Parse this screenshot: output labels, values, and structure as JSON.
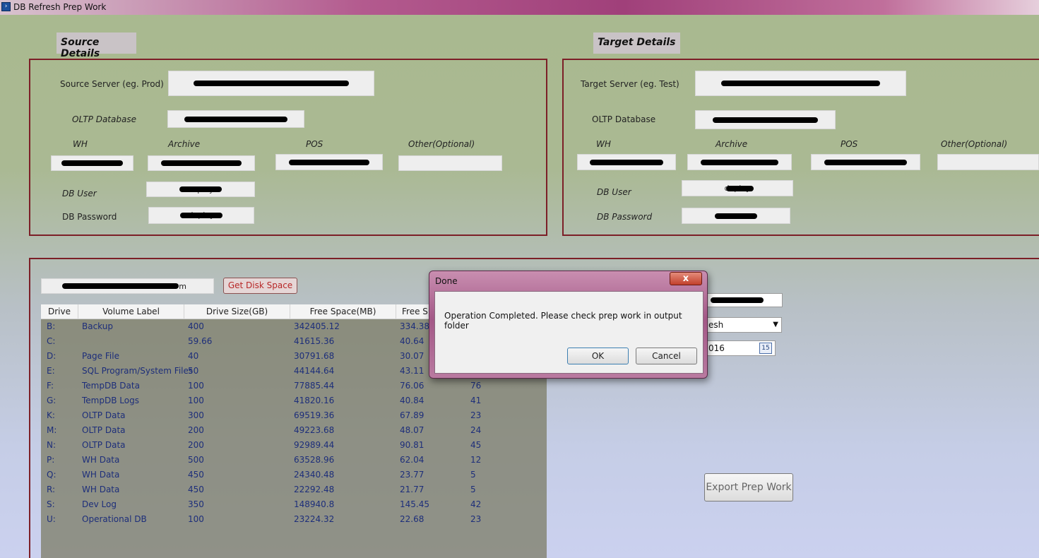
{
  "window": {
    "title": "DB Refresh Prep Work",
    "icon": "powershell-icon"
  },
  "source": {
    "heading": "Source Details",
    "server_label": "Source Server (eg. Prod)",
    "oltp_label": "OLTP Database",
    "wh_label": "WH",
    "archive_label": "Archive",
    "pos_label": "POS",
    "other_label": "Other(Optional)",
    "user_label": "DB User",
    "user_value": "deploy",
    "password_label": "DB Password",
    "password_value": "deploy"
  },
  "target": {
    "heading": "Target Details",
    "server_label": "Target Server (eg. Test)",
    "oltp_label": "OLTP Database",
    "wh_label": "WH",
    "archive_label": "Archive",
    "pos_label": "POS",
    "other_label": "Other(Optional)",
    "user_label": "DB User",
    "user_value": "deploy",
    "password_label": "DB Password"
  },
  "disk": {
    "server_value": "m",
    "get_button": "Get Disk Space",
    "columns": [
      "Drive",
      "Volume Label",
      "Drive Size(GB)",
      "Free Space(MB)",
      "Free Sp"
    ],
    "rows": [
      {
        "drive": "B:",
        "label": "Backup",
        "size": "400",
        "free_mb": "342405.12",
        "free_gb": "334.38",
        "pct": ""
      },
      {
        "drive": "C:",
        "label": "",
        "size": "59.66",
        "free_mb": "41615.36",
        "free_gb": "40.64",
        "pct": ""
      },
      {
        "drive": "D:",
        "label": "Page File",
        "size": "40",
        "free_mb": "30791.68",
        "free_gb": "30.07",
        "pct": ""
      },
      {
        "drive": "E:",
        "label": "SQL Program/System Files",
        "size": "50",
        "free_mb": "44144.64",
        "free_gb": "43.11",
        "pct": ""
      },
      {
        "drive": "F:",
        "label": "TempDB Data",
        "size": "100",
        "free_mb": "77885.44",
        "free_gb": "76.06",
        "pct": "76"
      },
      {
        "drive": "G:",
        "label": "TempDB Logs",
        "size": "100",
        "free_mb": "41820.16",
        "free_gb": "40.84",
        "pct": "41"
      },
      {
        "drive": "K:",
        "label": "OLTP Data",
        "size": "300",
        "free_mb": "69519.36",
        "free_gb": "67.89",
        "pct": "23"
      },
      {
        "drive": "M:",
        "label": "OLTP Data",
        "size": "200",
        "free_mb": "49223.68",
        "free_gb": "48.07",
        "pct": "24"
      },
      {
        "drive": "N:",
        "label": "OLTP Data",
        "size": "200",
        "free_mb": "92989.44",
        "free_gb": "90.81",
        "pct": "45"
      },
      {
        "drive": "P:",
        "label": "WH Data",
        "size": "500",
        "free_mb": "63528.96",
        "free_gb": "62.04",
        "pct": "12"
      },
      {
        "drive": "Q:",
        "label": "WH Data",
        "size": "450",
        "free_mb": "24340.48",
        "free_gb": "23.77",
        "pct": "5"
      },
      {
        "drive": "R:",
        "label": "WH Data",
        "size": "450",
        "free_mb": "22292.48",
        "free_gb": "21.77",
        "pct": "5"
      },
      {
        "drive": "S:",
        "label": "Dev Log",
        "size": "350",
        "free_mb": "148940.8",
        "free_gb": "145.45",
        "pct": "42"
      },
      {
        "drive": "U:",
        "label": "Operational DB",
        "size": "100",
        "free_mb": "23224.32",
        "free_gb": "22.68",
        "pct": "23"
      }
    ]
  },
  "options": {
    "refresh_type": "esh",
    "date_value": "016",
    "calendar_day": "15",
    "export_button": "Export Prep Work"
  },
  "dialog": {
    "title": "Done",
    "message": "Operation Completed. Please check prep work in output folder",
    "ok": "OK",
    "cancel": "Cancel",
    "close_glyph": "x"
  }
}
